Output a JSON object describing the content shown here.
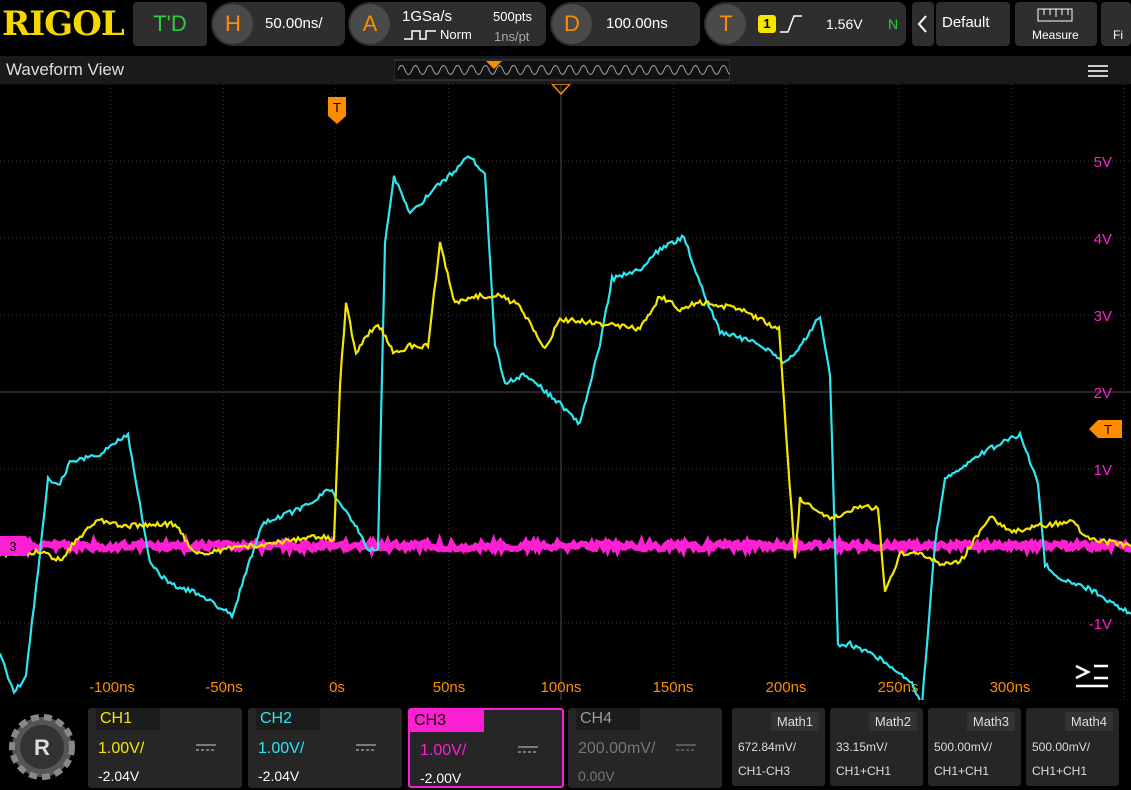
{
  "topbar": {
    "logo": "RIGOL",
    "run_mode": "T'D",
    "horizontal": {
      "letter": "H",
      "timebase": "50.00ns/"
    },
    "acquire": {
      "letter": "A",
      "sample_rate": "1GSa/s",
      "points": "500pts",
      "mode": "Norm",
      "interval": "1ns/pt"
    },
    "delay": {
      "letter": "D",
      "value": "100.00ns"
    },
    "trigger": {
      "letter": "T",
      "source": "1",
      "level": "1.56V",
      "status": "N"
    },
    "default_label": "Default",
    "measure_label": "Measure",
    "file_label": "Fi"
  },
  "waveform_view": {
    "title": "Waveform View",
    "y_labels": [
      "5V",
      "4V",
      "3V",
      "2V",
      "1V",
      "-1V"
    ],
    "x_labels": [
      "-100ns",
      "-50ns",
      "0s",
      "50ns",
      "100ns",
      "150ns",
      "200ns",
      "250ns",
      "300ns"
    ],
    "trigger_marker": "T",
    "ch3_marker": "3"
  },
  "channels": [
    {
      "name": "CH1",
      "scale": "1.00V/",
      "offset": "-2.04V",
      "color": "#f5e600"
    },
    {
      "name": "CH2",
      "scale": "1.00V/",
      "offset": "-2.04V",
      "color": "#2ee6f0"
    },
    {
      "name": "CH3",
      "scale": "1.00V/",
      "offset": "-2.00V",
      "color": "#ff1fd2"
    },
    {
      "name": "CH4",
      "scale": "200.00mV/",
      "offset": "0.00V",
      "color": "#777777"
    }
  ],
  "math": [
    {
      "name": "Math1",
      "value": "672.84mV/",
      "source": "CH1-CH3"
    },
    {
      "name": "Math2",
      "value": "33.15mV/",
      "source": "CH1+CH1"
    },
    {
      "name": "Math3",
      "value": "500.00mV/",
      "source": "CH1+CH1"
    },
    {
      "name": "Math4",
      "value": "500.00mV/",
      "source": "CH1+CH1"
    }
  ],
  "colors": {
    "accent": "#ff8c00",
    "ch1": "#f5e600",
    "ch2": "#2ee6f0",
    "ch3": "#ff1fd2",
    "grid": "#3a3a3a"
  },
  "icons": {
    "menu": "hamburger-icon",
    "collapse": "collapse-arrows-icon",
    "home": "rigol-gear-icon"
  }
}
